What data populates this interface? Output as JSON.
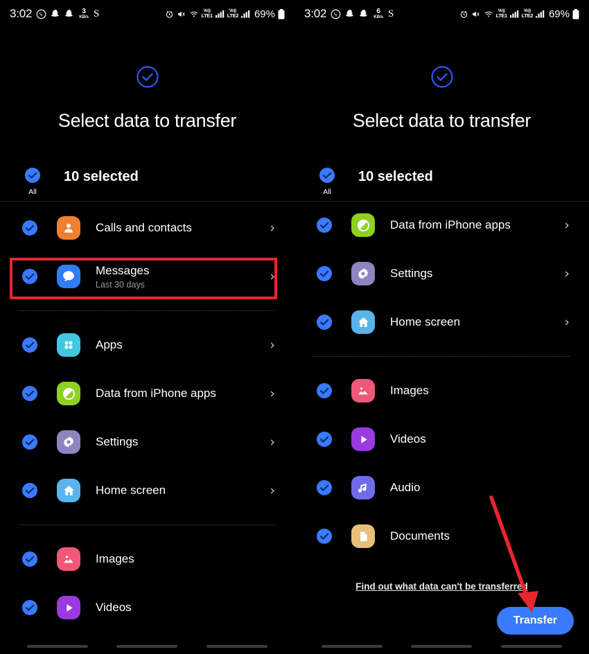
{
  "theme": {
    "background": "#000000",
    "accent_blue": "#3a7afe",
    "checkbox_blue": "#3a7afe",
    "highlight_red": "#e8262d",
    "text_primary": "#ffffff",
    "text_secondary": "#9a9a9a",
    "divider": "#4a4a4a"
  },
  "panels": [
    {
      "id": "left-panel",
      "status_bar": {
        "clock": "3:02",
        "net_speed_value": "3",
        "net_speed_unit": "KB/s",
        "battery_percent": "69%",
        "signal_1_label_top": "Vo))",
        "signal_1_label_bottom": "LTE1",
        "signal_2_label_top": "Vo))",
        "signal_2_label_bottom": "LTE2",
        "left_icons": [
          "whatsapp-icon",
          "snapchat-icon",
          "snapchat-icon",
          "net-speed-indicator",
          "samsung-pay-icon"
        ],
        "right_icons": [
          "alarm-icon",
          "mute-icon",
          "wifi-icon",
          "volte1-signal-icon",
          "volte2-signal-icon",
          "battery-icon"
        ]
      },
      "header": {
        "icon": "check-circle-outline-icon",
        "title": "Select data to transfer"
      },
      "select_all": {
        "checked": true,
        "all_label": "All",
        "count_text": "10 selected"
      },
      "items": [
        {
          "label": "Calls and contacts",
          "sublabel": "",
          "icon": "person-icon",
          "icon_color": "#f08030",
          "checked": true,
          "chevron": true,
          "highlighted": false,
          "divider_after": false
        },
        {
          "label": "Messages",
          "sublabel": "Last 30 days",
          "icon": "message-bubble-icon",
          "icon_color": "#2f7ef5",
          "checked": true,
          "chevron": true,
          "highlighted": true,
          "divider_after": true
        },
        {
          "label": "Apps",
          "sublabel": "",
          "icon": "apps-grid-icon",
          "icon_color": "#3fc8e0",
          "checked": true,
          "chevron": true,
          "highlighted": false,
          "divider_after": false
        },
        {
          "label": "Data from iPhone apps",
          "sublabel": "",
          "icon": "pie-chart-icon",
          "icon_color": "#8ed122",
          "checked": true,
          "chevron": true,
          "highlighted": false,
          "divider_after": false
        },
        {
          "label": "Settings",
          "sublabel": "",
          "icon": "gear-icon",
          "icon_color": "#8b86c0",
          "checked": true,
          "chevron": true,
          "highlighted": false,
          "divider_after": false
        },
        {
          "label": "Home screen",
          "sublabel": "",
          "icon": "home-icon",
          "icon_color": "#58b4ea",
          "checked": true,
          "chevron": true,
          "highlighted": false,
          "divider_after": true
        },
        {
          "label": "Images",
          "sublabel": "",
          "icon": "image-icon",
          "icon_color": "#ef5878",
          "checked": true,
          "chevron": false,
          "highlighted": false,
          "divider_after": false
        },
        {
          "label": "Videos",
          "sublabel": "",
          "icon": "play-icon",
          "icon_color": "#9b3ae0",
          "checked": true,
          "chevron": false,
          "highlighted": false,
          "divider_after": false
        }
      ],
      "footer_link": "",
      "transfer_button": "",
      "has_arrow": false
    },
    {
      "id": "right-panel",
      "status_bar": {
        "clock": "3:02",
        "net_speed_value": "6",
        "net_speed_unit": "KB/s",
        "battery_percent": "69%",
        "signal_1_label_top": "Vo))",
        "signal_1_label_bottom": "LTE1",
        "signal_2_label_top": "Vo))",
        "signal_2_label_bottom": "LTE2",
        "left_icons": [
          "whatsapp-icon",
          "snapchat-icon",
          "snapchat-icon",
          "net-speed-indicator",
          "samsung-pay-icon"
        ],
        "right_icons": [
          "alarm-icon",
          "mute-icon",
          "wifi-icon",
          "volte1-signal-icon",
          "volte2-signal-icon",
          "battery-icon"
        ]
      },
      "header": {
        "icon": "check-circle-outline-icon",
        "title": "Select data to transfer"
      },
      "select_all": {
        "checked": true,
        "all_label": "All",
        "count_text": "10 selected"
      },
      "items": [
        {
          "label": "Data from iPhone apps",
          "sublabel": "",
          "icon": "pie-chart-icon",
          "icon_color": "#8ed122",
          "checked": true,
          "chevron": true,
          "highlighted": false,
          "divider_after": false
        },
        {
          "label": "Settings",
          "sublabel": "",
          "icon": "gear-icon",
          "icon_color": "#8b86c0",
          "checked": true,
          "chevron": true,
          "highlighted": false,
          "divider_after": false
        },
        {
          "label": "Home screen",
          "sublabel": "",
          "icon": "home-icon",
          "icon_color": "#58b4ea",
          "checked": true,
          "chevron": true,
          "highlighted": false,
          "divider_after": true
        },
        {
          "label": "Images",
          "sublabel": "",
          "icon": "image-icon",
          "icon_color": "#ef5878",
          "checked": true,
          "chevron": false,
          "highlighted": false,
          "divider_after": false
        },
        {
          "label": "Videos",
          "sublabel": "",
          "icon": "play-icon",
          "icon_color": "#9b3ae0",
          "checked": true,
          "chevron": false,
          "highlighted": false,
          "divider_after": false
        },
        {
          "label": "Audio",
          "sublabel": "",
          "icon": "music-note-icon",
          "icon_color": "#6f6bea",
          "checked": true,
          "chevron": false,
          "highlighted": false,
          "divider_after": false
        },
        {
          "label": "Documents",
          "sublabel": "",
          "icon": "document-icon",
          "icon_color": "#e8c07a",
          "checked": true,
          "chevron": false,
          "highlighted": false,
          "divider_after": false
        }
      ],
      "footer_link": "Find out what data can't be transferred",
      "transfer_button": "Transfer",
      "has_arrow": true
    }
  ],
  "navbar": {
    "items": [
      "recents-button",
      "home-button",
      "back-button"
    ]
  },
  "annotations": {
    "red_box_target": "Messages",
    "red_arrow_target": "Transfer"
  }
}
